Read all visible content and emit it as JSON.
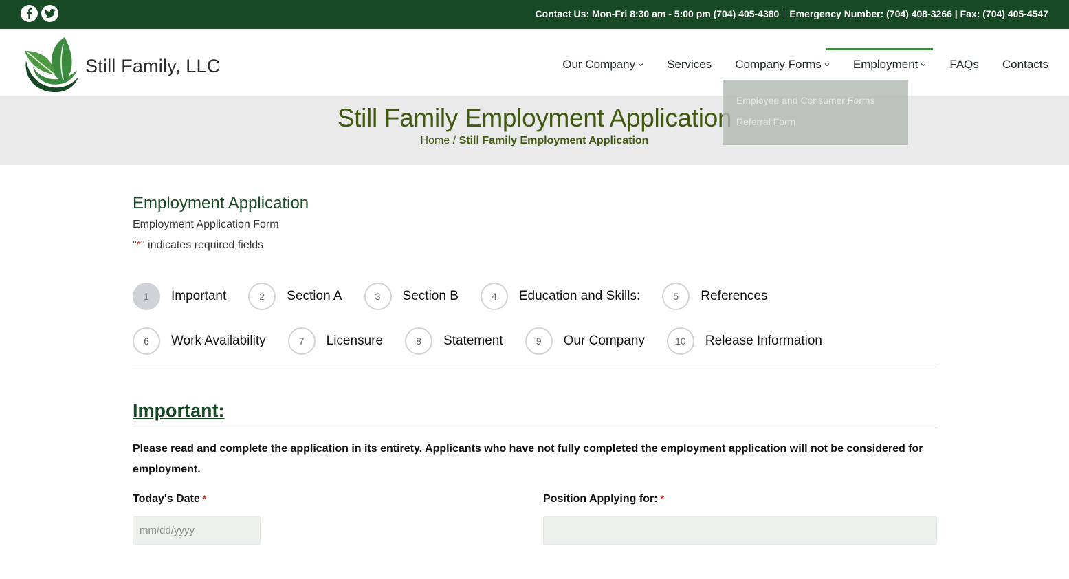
{
  "topbar": {
    "contact": "Contact Us: Mon-Fri 8:30 am - 5:00 pm (704) 405-4380",
    "emergency": "Emergency Number: (704) 408-3266 | Fax: (704) 405-4547"
  },
  "brand": {
    "name": "Still Family, LLC",
    "primary_color": "#174a24",
    "accent_color": "#3c8a3f"
  },
  "nav": {
    "items": [
      {
        "label": "Our Company",
        "has_dropdown": true
      },
      {
        "label": "Services",
        "has_dropdown": false
      },
      {
        "label": "Company Forms",
        "has_dropdown": true
      },
      {
        "label": "Employment",
        "has_dropdown": true,
        "active": true
      },
      {
        "label": "FAQs",
        "has_dropdown": false
      },
      {
        "label": "Contacts",
        "has_dropdown": false
      }
    ],
    "dropdown": [
      "Employee and Consumer Forms",
      "Referral Form"
    ]
  },
  "page": {
    "title": "Still Family Employment Application",
    "breadcrumb_home": "Home",
    "breadcrumb_sep": " / ",
    "breadcrumb_current": "Still Family Employment Application"
  },
  "form": {
    "title": "Employment Application",
    "description": "Employment Application Form",
    "req_prefix": "\"",
    "req_star": "*",
    "req_suffix": "\" indicates required fields",
    "steps": [
      {
        "num": "1",
        "label": "Important",
        "active": true
      },
      {
        "num": "2",
        "label": "Section A"
      },
      {
        "num": "3",
        "label": "Section B"
      },
      {
        "num": "4",
        "label": "Education and Skills:"
      },
      {
        "num": "5",
        "label": "References"
      },
      {
        "num": "6",
        "label": "Work Availability"
      },
      {
        "num": "7",
        "label": "Licensure"
      },
      {
        "num": "8",
        "label": "Statement"
      },
      {
        "num": "9",
        "label": "Our Company"
      },
      {
        "num": "10",
        "label": "Release Information"
      }
    ],
    "section_heading": "Important:",
    "notice": "Please read and complete the application in its entirety. Applicants who have not fully completed the employment application will not be considered for employment.",
    "fields": {
      "date_label": "Today's Date",
      "date_placeholder": "mm/dd/yyyy",
      "date_value": "",
      "position_label": "Position Applying for:",
      "position_value": "",
      "required_star": "*"
    }
  }
}
